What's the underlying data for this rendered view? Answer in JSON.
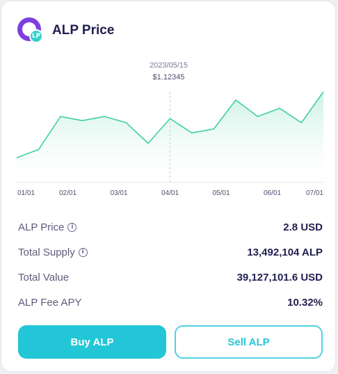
{
  "header": {
    "logo_badge": "LP",
    "title": "ALP Price"
  },
  "chart_data": {
    "type": "area",
    "x_tick_labels": [
      "01/01",
      "02/01",
      "03/01",
      "04/01",
      "05/01",
      "06/01",
      "07/01"
    ],
    "values": [
      0.6,
      0.8,
      1.6,
      1.5,
      1.6,
      1.45,
      0.95,
      1.55,
      1.2,
      1.3,
      2.0,
      1.6,
      1.8,
      1.45,
      2.2
    ],
    "ylim": [
      0,
      2.5
    ],
    "tooltip": {
      "date": "2023/05/15",
      "price": "$1.12345"
    },
    "line_color": "#3fcfa6",
    "fill_color": "#d9f5ec",
    "grid": false
  },
  "stats": [
    {
      "label": "ALP Price",
      "has_info": true,
      "value": "2.8 USD"
    },
    {
      "label": "Total Supply",
      "has_info": true,
      "value": "13,492,104 ALP"
    },
    {
      "label": "Total Value",
      "has_info": false,
      "value": "39,127,101.6 USD"
    },
    {
      "label": "ALP Fee APY",
      "has_info": false,
      "value": "10.32%"
    }
  ],
  "icons": {
    "info": "info-icon"
  },
  "buttons": {
    "buy_label": "Buy ALP",
    "sell_label": "Sell ALP"
  },
  "colors": {
    "accent": "#23c6d6",
    "brand": "#7d3fe0",
    "text_dark": "#221f4f"
  }
}
